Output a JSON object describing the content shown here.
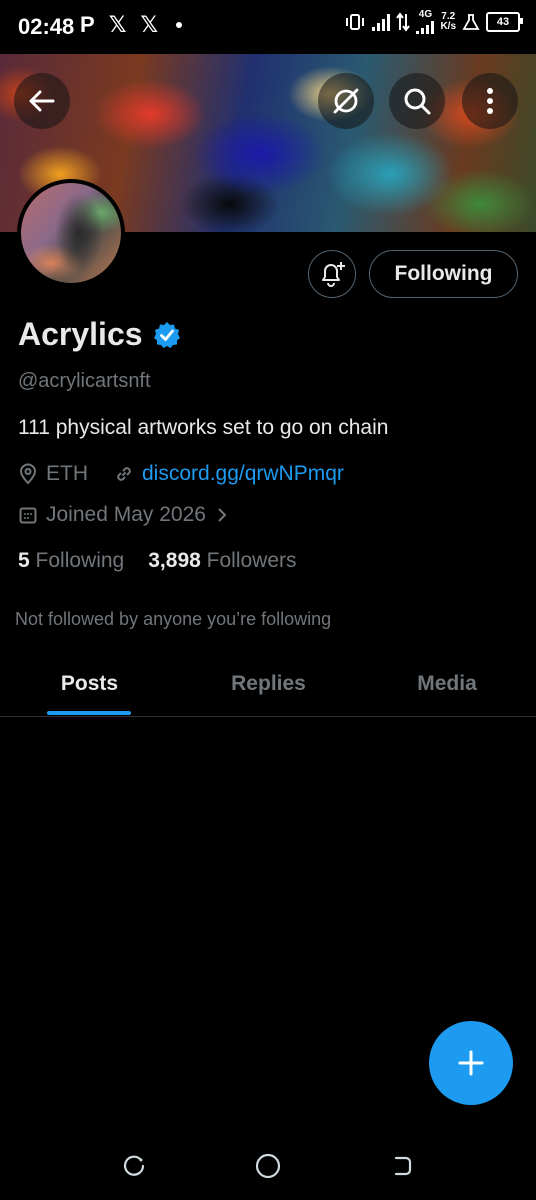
{
  "status_bar": {
    "time": "02:48",
    "left_icons": [
      "P",
      "𝕏",
      "𝕏"
    ],
    "network": "4G",
    "speed_value": "7.2",
    "speed_unit": "K/s",
    "battery": "43"
  },
  "header": {
    "back_icon": "arrow-left-icon",
    "grok_icon": "grok-icon",
    "search_icon": "search-icon",
    "more_icon": "more-vertical-icon"
  },
  "profile": {
    "name": "Acrylics",
    "verified": true,
    "handle": "@acrylicartsnft",
    "bio": "111 physical artworks set to go on chain",
    "location": "ETH",
    "link": "discord.gg/qrwNPmqr",
    "joined": "Joined May 2026",
    "following_count": "5",
    "following_label": "Following",
    "followers_count": "3,898",
    "followers_label": "Followers",
    "not_followed_text": "Not followed by anyone you’re following",
    "follow_button_label": "Following",
    "accent_color": "#1d9bf0"
  },
  "tabs": [
    {
      "label": "Posts",
      "active": true
    },
    {
      "label": "Replies",
      "active": false
    },
    {
      "label": "Media",
      "active": false
    }
  ],
  "fab": {
    "icon": "plus-icon"
  },
  "nav_bar": {
    "icons": [
      "recents-icon",
      "home-icon",
      "back-icon"
    ]
  }
}
